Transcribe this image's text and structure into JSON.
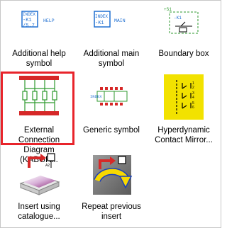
{
  "items": [
    {
      "label": "Additional help symbol",
      "icon": "additional-help-symbol-icon",
      "texts": [
        "INDEX",
        "-K1",
        "/5.7",
        "HELP"
      ]
    },
    {
      "label": "Additional main symbol",
      "icon": "additional-main-symbol-icon",
      "texts": [
        "INDEX",
        "-K1",
        "MAIN"
      ]
    },
    {
      "label": "Boundary box",
      "icon": "boundary-box-icon",
      "texts": [
        "+S1",
        "-K1"
      ]
    },
    {
      "label": "External Connection Diagram (KABGR...",
      "icon": "external-connection-diagram-icon",
      "selected": true
    },
    {
      "label": "Generic symbol",
      "icon": "generic-symbol-icon",
      "texts": [
        "INDEX"
      ]
    },
    {
      "label": "Hyperdynamic Contact Mirror...",
      "icon": "hyperdynamic-contact-mirror-icon"
    },
    {
      "label": "Insert using catalogue...",
      "icon": "insert-using-catalogue-icon"
    },
    {
      "label": "Repeat previous insert",
      "icon": "repeat-previous-insert-icon"
    }
  ],
  "colors": {
    "selection": "#e8242b",
    "symbol_blue": "#1f6fd1",
    "symbol_green": "#2f9a2f",
    "symbol_red": "#d62828",
    "yellow": "#f2e200",
    "arrow_yellow": "#f7d800",
    "arrow_blue": "#1a3fb8"
  }
}
